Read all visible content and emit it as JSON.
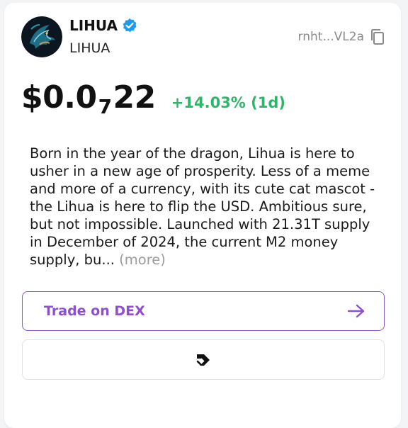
{
  "token": {
    "name": "LIHUA",
    "symbol": "LIHUA",
    "address_short": "rnht...VL2a",
    "price_prefix": "$0.0",
    "price_zero_count": "7",
    "price_suffix": "22",
    "change": "+14.03% (1d)",
    "verified": true
  },
  "description": {
    "text": "Born in the year of the dragon, Lihua is here to usher in a new age of prosperity. Less of a meme and more of a currency, with its cute cat mascot - the Lihua is here to flip the USD. Ambitious sure, but not impossible. Launched with 21.31T supply in December of 2024, the current M2 money supply, bu...",
    "more_label": "(more)"
  },
  "buttons": {
    "trade_label": "Trade on DEX"
  },
  "icons": {
    "verified": "verified-check-icon",
    "copy": "copy-icon",
    "arrow": "arrow-right-icon",
    "dex": "dex-logo-icon"
  },
  "colors": {
    "accent_purple": "#8d4fd0",
    "positive_green": "#2fb56a",
    "verified_blue": "#1d9bf0",
    "muted_gray": "#9b9b9b"
  }
}
